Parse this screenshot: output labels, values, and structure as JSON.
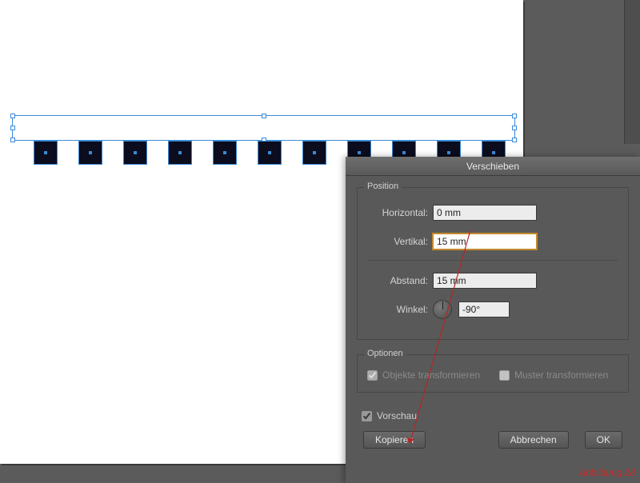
{
  "dialog": {
    "title": "Verschieben",
    "position_group": "Position",
    "horizontal_label": "Horizontal:",
    "horizontal_value": "0 mm",
    "vertikal_label": "Vertikal:",
    "vertikal_value": "15 mm",
    "abstand_label": "Abstand:",
    "abstand_value": "15 mm",
    "winkel_label": "Winkel:",
    "winkel_value": "-90°",
    "optionen_group": "Optionen",
    "objekte_label": "Objekte transformieren",
    "muster_label": "Muster transformieren",
    "vorschau_label": "Vorschau",
    "btn_kopieren": "Kopieren",
    "btn_abbrechen": "Abbrechen",
    "btn_ok": "OK"
  },
  "caption": "Abbildung 28",
  "artboard": {
    "squares_count": 11
  }
}
